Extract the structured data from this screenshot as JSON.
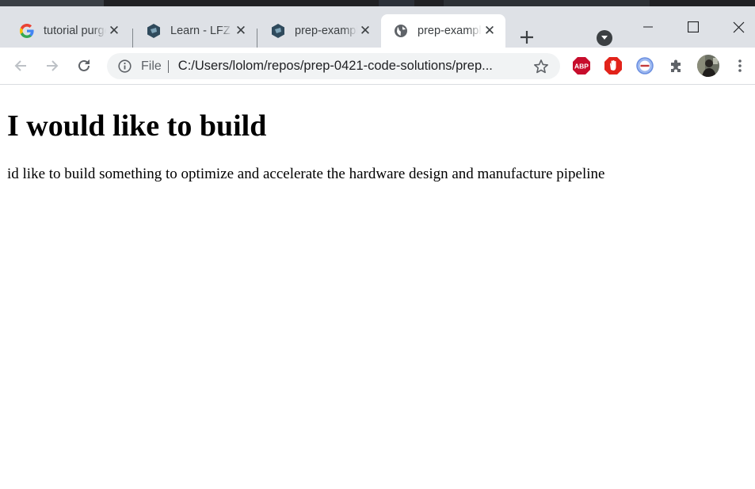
{
  "browser": {
    "tabs": [
      {
        "title": "tutorial purge",
        "favicon": "google-icon",
        "active": false
      },
      {
        "title": "Learn - LFZ",
        "favicon": "lfz-icon",
        "active": false
      },
      {
        "title": "prep-example",
        "favicon": "lfz-icon",
        "active": false
      },
      {
        "title": "prep-example",
        "favicon": "globe-icon",
        "active": true
      }
    ],
    "new_tab_label": "+",
    "address_bar": {
      "scheme_label": "File",
      "url": "C:/Users/lolom/repos/prep-0421-code-solutions/prep..."
    },
    "extensions": [
      {
        "name": "adblock-plus-icon",
        "label": "ABP",
        "color": "#c70d2c"
      },
      {
        "name": "adblock-hand-icon",
        "color": "#e2231a"
      },
      {
        "name": "wappalyzer-icon",
        "color": "#6b8fe0"
      },
      {
        "name": "extensions-puzzle-icon",
        "color": "#5f6368"
      }
    ],
    "colors": {
      "tabbar": "#dee1e6",
      "active_tab": "#ffffff",
      "omnibox": "#f1f3f4"
    }
  },
  "page": {
    "heading": "I would like to build",
    "paragraph": "id like to build something to optimize and accelerate the hardware design and manufacture pipeline"
  }
}
